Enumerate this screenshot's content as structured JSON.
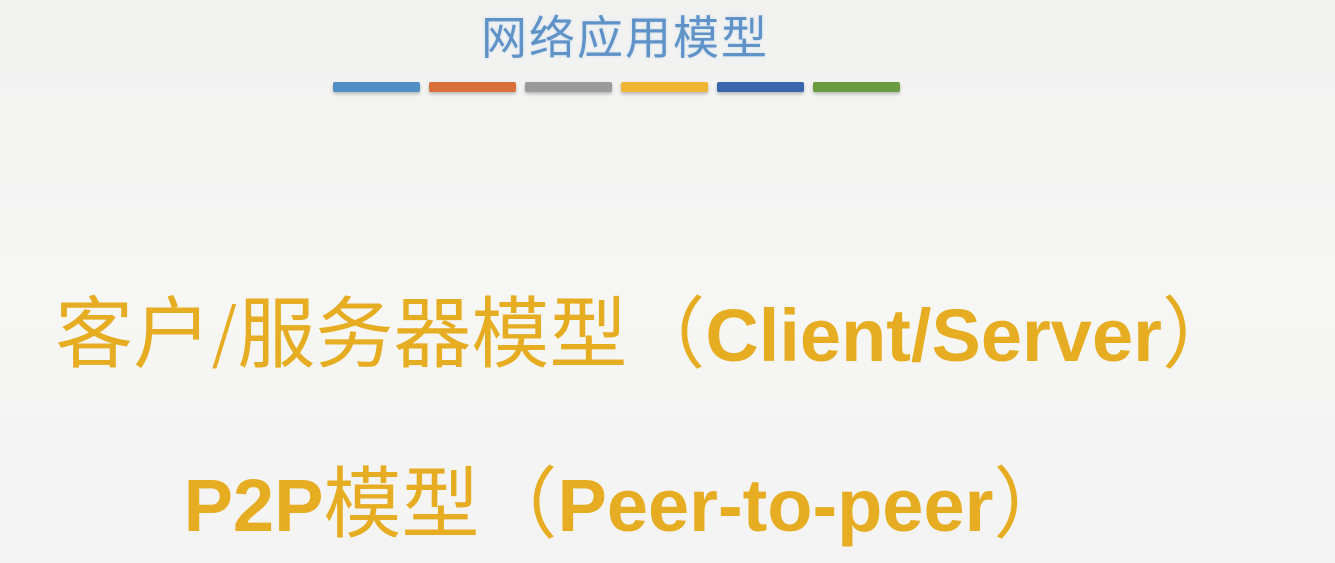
{
  "slide": {
    "title": "网络应用模型",
    "color_bars": [
      "#4f8fc6",
      "#d9703a",
      "#9a9a9a",
      "#f1b534",
      "#3a66ac",
      "#6b9b3f"
    ],
    "items": [
      {
        "cn": "客户/服务器模型",
        "paren_open": "（",
        "en": "Client/Server",
        "paren_close": "）"
      },
      {
        "cn_prefix": "P2P",
        "cn": "模型",
        "paren_open": "（",
        "en": "Peer-to-peer",
        "paren_close": "）"
      }
    ],
    "text_color": "#e6ad22",
    "title_color": "#5f93c8"
  }
}
